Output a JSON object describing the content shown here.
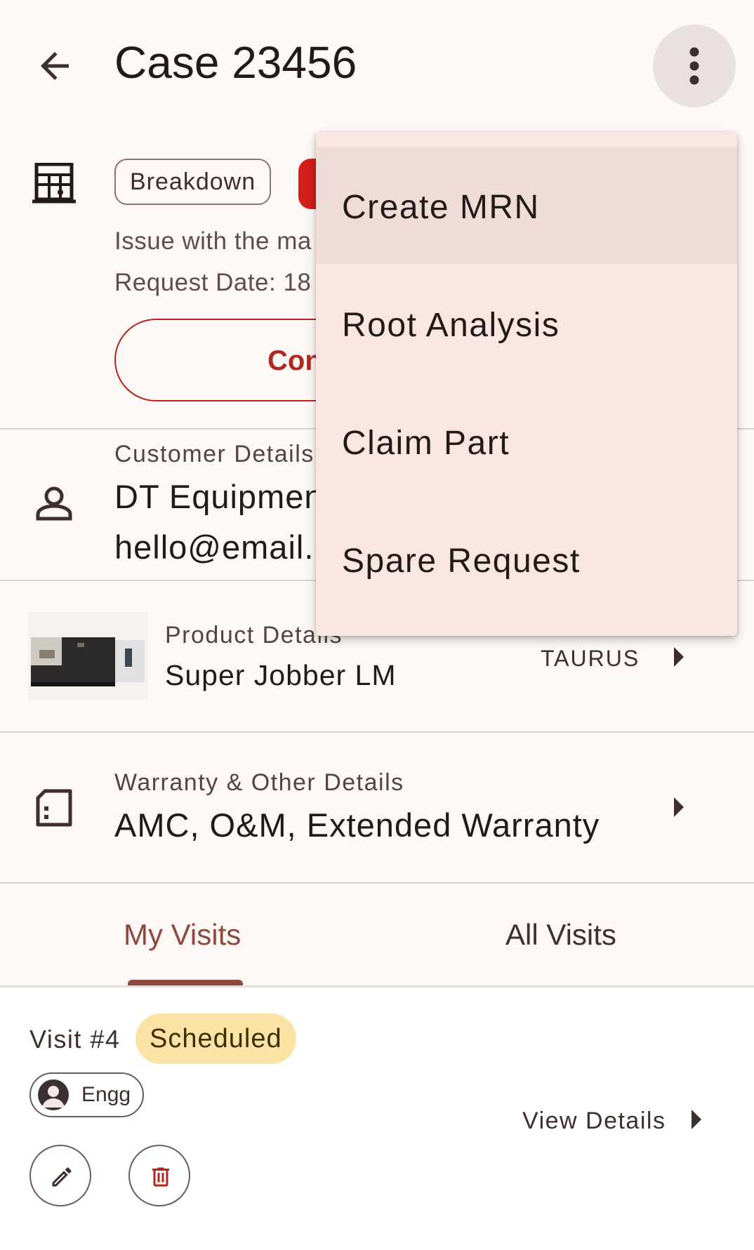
{
  "topbar": {
    "title": "Case 23456",
    "back_icon": "arrow-left-icon",
    "more_icon": "more-vert-icon"
  },
  "case": {
    "type_chip": "Breakdown",
    "status_chip_color": "#d21f1b",
    "issue_text": "Issue with the ma",
    "request_date_text": "Request Date: 18",
    "confirm_button": "Con"
  },
  "customer": {
    "label": "Customer Details",
    "name": "DT Equipmen",
    "email": "hello@email."
  },
  "product": {
    "label": "Product Details",
    "name": "Super Jobber LM",
    "brand": "TAURUS"
  },
  "warranty": {
    "label": "Warranty & Other Details",
    "value": "AMC, O&M, Extended Warranty"
  },
  "tabs": [
    {
      "label": "My Visits",
      "active": true
    },
    {
      "label": "All Visits",
      "active": false
    }
  ],
  "visit": {
    "title": "Visit #4",
    "status": "Scheduled",
    "engineer": "Engg",
    "view_details": "View Details"
  },
  "menu": {
    "items": [
      {
        "label": "Create MRN",
        "highlighted": true
      },
      {
        "label": "Root Analysis"
      },
      {
        "label": "Claim Part"
      },
      {
        "label": "Spare Request"
      }
    ]
  },
  "colors": {
    "accent": "#8c4a3e",
    "primary_red": "#b3261e",
    "scheduled_bg": "#fbe3a6",
    "background": "#fdf7f5"
  }
}
